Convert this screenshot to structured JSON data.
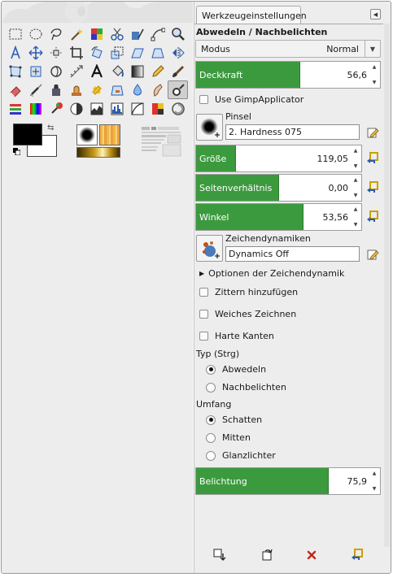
{
  "dock": {
    "tab_label": "Werkzeugeinstellungen",
    "tool_title": "Abwedeln / Nachbelichten",
    "mode": {
      "label": "Modus",
      "value": "Normal"
    },
    "opacity": {
      "label": "Deckkraft",
      "value": "56,6",
      "fraction": 0.566
    },
    "use_applicator": {
      "label": "Use GimpApplicator",
      "checked": false
    },
    "brush": {
      "section": "Pinsel",
      "value": "2. Hardness 075"
    },
    "size": {
      "label": "Größe",
      "value": "119,05",
      "fraction": 0.24
    },
    "aspect": {
      "label": "Seitenverhältnis",
      "value": "0,00",
      "fraction": 0.5
    },
    "angle": {
      "label": "Winkel",
      "value": "53,56",
      "fraction": 0.65
    },
    "dynamics": {
      "section": "Zeichendynamiken",
      "value": "Dynamics Off"
    },
    "dynamics_options": "Optionen der Zeichendynamik",
    "jitter": {
      "label": "Zittern hinzufügen",
      "checked": false
    },
    "smooth": {
      "label": "Weiches Zeichnen",
      "checked": false
    },
    "hard": {
      "label": "Harte Kanten",
      "checked": false
    },
    "type": {
      "label": "Typ (Strg)",
      "options": [
        {
          "label": "Abwedeln",
          "selected": true
        },
        {
          "label": "Nachbelichten",
          "selected": false
        }
      ]
    },
    "range": {
      "label": "Umfang",
      "options": [
        {
          "label": "Schatten",
          "selected": true
        },
        {
          "label": "Mitten",
          "selected": false
        },
        {
          "label": "Glanzlichter",
          "selected": false
        }
      ]
    },
    "exposure": {
      "label": "Belichtung",
      "value": "75,9",
      "fraction": 0.72
    }
  },
  "colors": {
    "fill_green": "#3c9a3e",
    "foreground": "#000000",
    "background": "#ffffff"
  },
  "toolbox": {
    "icons": [
      "rect-select-icon",
      "ellipse-select-icon",
      "lasso-icon",
      "fuzzy-select-icon",
      "color-select-icon",
      "scissors-select-icon",
      "foreground-select-icon",
      "paths-icon",
      "zoom-icon",
      "text-align-icon",
      "move-icon",
      "alignment-icon",
      "crop-icon",
      "rotate-icon",
      "scale-icon",
      "shear-icon",
      "perspective-icon",
      "flip-icon",
      "cage-transform-icon",
      "unified-transform-icon",
      "warp-transform-icon",
      "measure-icon",
      "text-icon",
      "bucket-fill-icon",
      "blend-icon",
      "pencil-icon",
      "paintbrush-icon",
      "eraser-icon",
      "airbrush-icon",
      "ink-icon",
      "clone-icon",
      "heal-icon",
      "perspective-clone-icon",
      "blur-icon",
      "smudge-icon",
      "dodge-burn-icon",
      "color-balance-icon",
      "hue-saturation-icon",
      "colorize-icon",
      "brightness-contrast-icon",
      "threshold-icon",
      "levels-icon",
      "curves-icon",
      "posterize-icon",
      "desaturate-icon"
    ],
    "active_index": 35
  }
}
